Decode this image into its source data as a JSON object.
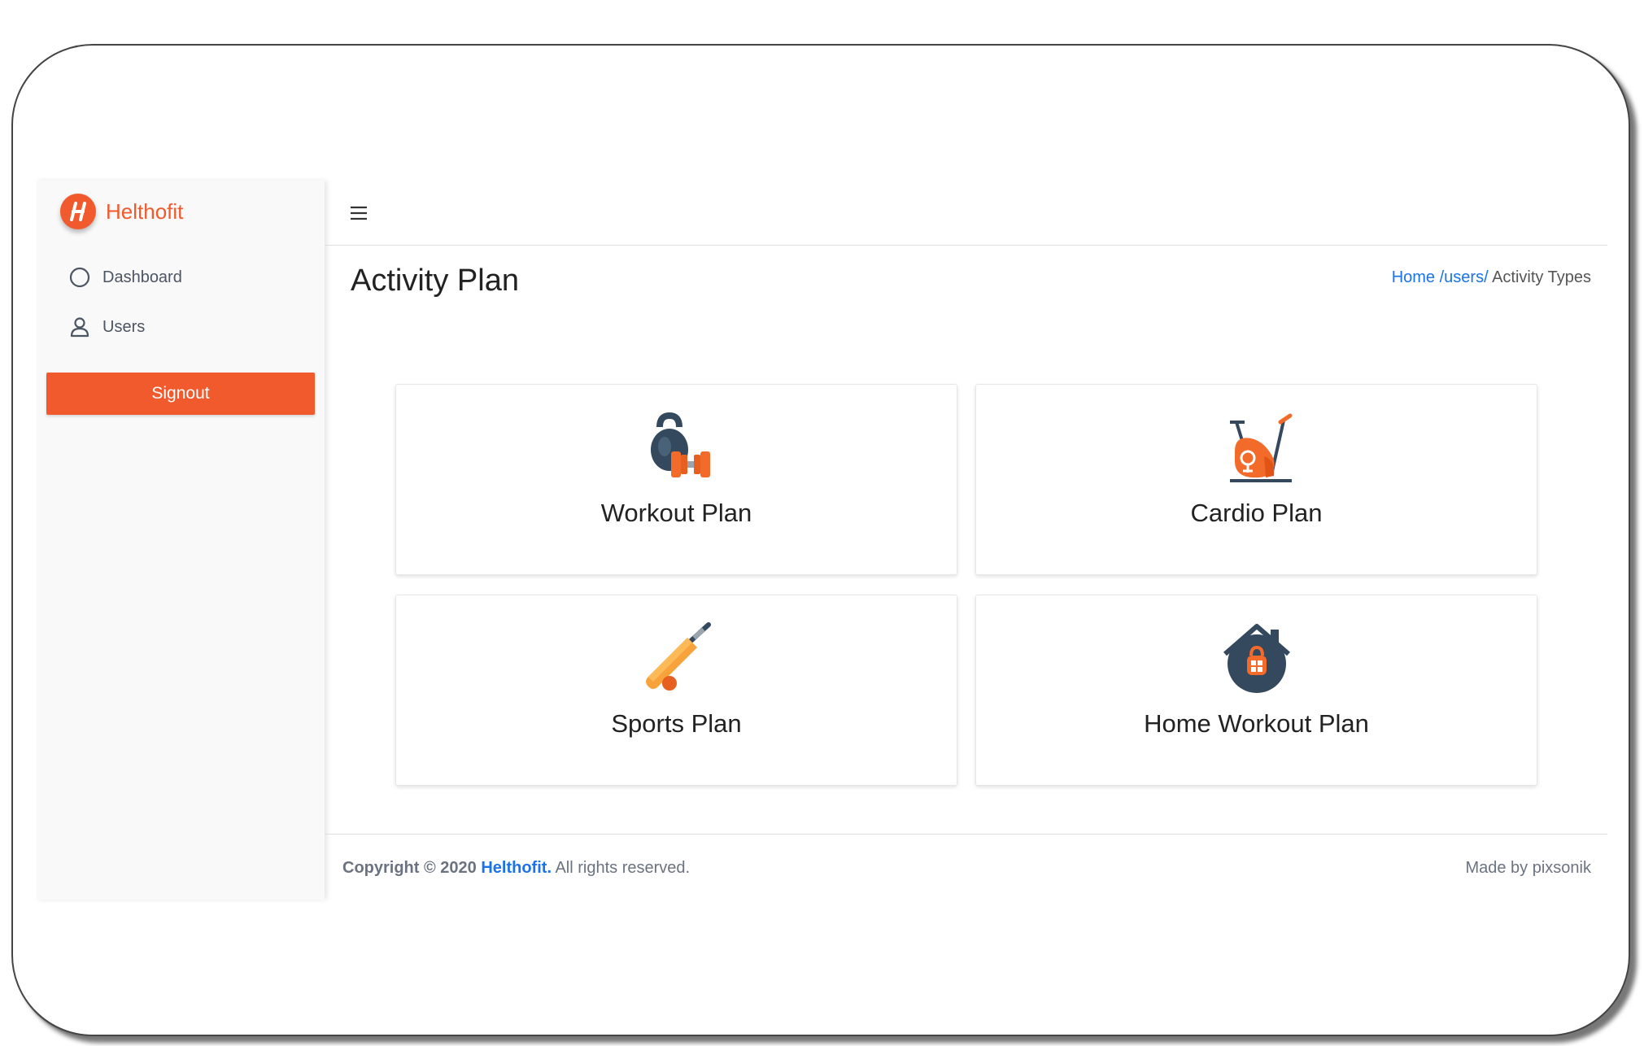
{
  "sidebar": {
    "brand": "Helthofit",
    "items": [
      {
        "label": "Dashboard",
        "icon": "circle-icon"
      },
      {
        "label": "Users",
        "icon": "user-icon"
      }
    ],
    "signout_label": "Signout"
  },
  "header": {
    "menu_icon": "hamburger-icon"
  },
  "page": {
    "title": "Activity Plan",
    "breadcrumb": {
      "home": "Home",
      "users": "/users/",
      "current": "Activity Types"
    }
  },
  "cards": [
    {
      "label": "Workout Plan",
      "icon": "kettlebell-dumbbell-icon"
    },
    {
      "label": "Cardio Plan",
      "icon": "exercise-bike-icon"
    },
    {
      "label": "Sports Plan",
      "icon": "cricket-bat-icon"
    },
    {
      "label": "Home Workout Plan",
      "icon": "home-kettlebell-icon"
    }
  ],
  "footer": {
    "copyright_prefix": "Copyright © 2020",
    "brand": "Helthofit.",
    "rights": "All rights reserved.",
    "made_by": "Made by pixsonik"
  },
  "colors": {
    "accent": "#f15a2c",
    "link": "#1a73e8",
    "dark_icon": "#34495e"
  }
}
